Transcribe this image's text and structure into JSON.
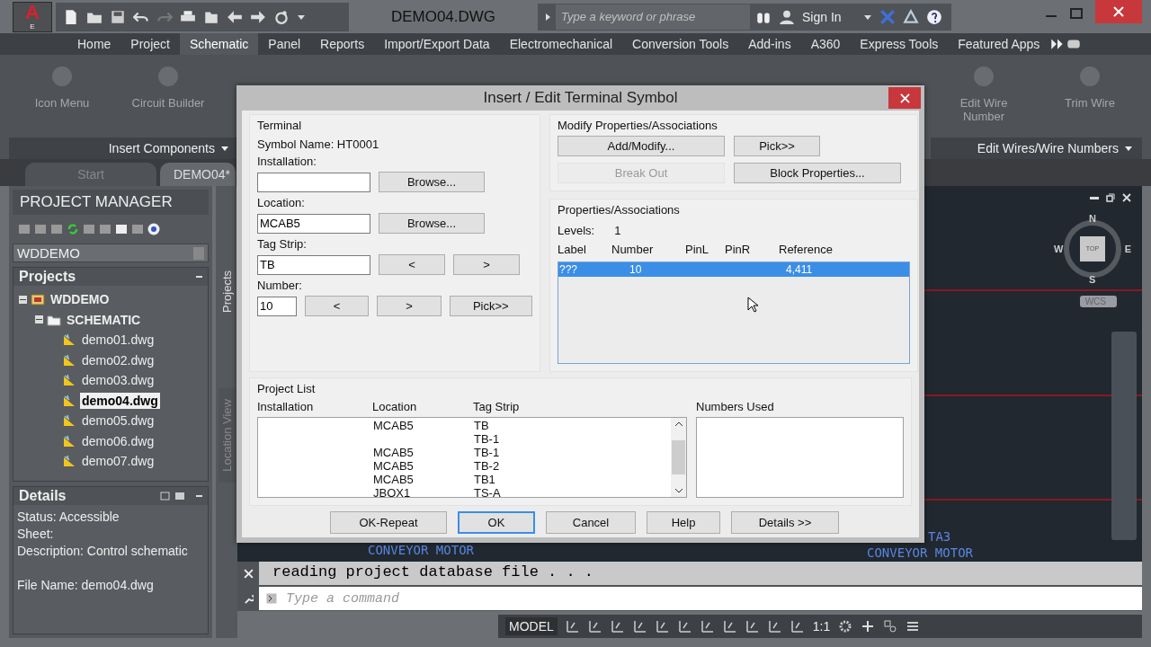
{
  "title_bar": {
    "app_letter": "A",
    "app_sub": "E",
    "document_title": "DEMO04.DWG",
    "search": {
      "placeholder": "Type a keyword or phrase"
    },
    "sign_in": "Sign In"
  },
  "ribbon_tabs": [
    {
      "label": "Home",
      "selected": false
    },
    {
      "label": "Project",
      "selected": false
    },
    {
      "label": "Schematic",
      "selected": true
    },
    {
      "label": "Panel",
      "selected": false
    },
    {
      "label": "Reports",
      "selected": false
    },
    {
      "label": "Import/Export Data",
      "selected": false
    },
    {
      "label": "Electromechanical",
      "selected": false
    },
    {
      "label": "Conversion Tools",
      "selected": false
    },
    {
      "label": "Add-ins",
      "selected": false
    },
    {
      "label": "A360",
      "selected": false
    },
    {
      "label": "Express Tools",
      "selected": false
    },
    {
      "label": "Featured Apps",
      "selected": false
    }
  ],
  "ribbon_panels": [
    {
      "title": "Insert Components",
      "tools": [
        "Icon Menu",
        "Circuit Builder"
      ]
    },
    {
      "title": "Edit Wires/Wire Numbers",
      "tools": [
        "Edit Wire Number",
        "Trim Wire"
      ]
    }
  ],
  "doc_tabs": [
    {
      "label": "Start",
      "selected": false
    },
    {
      "label": "DEMO04*",
      "selected": true
    }
  ],
  "project_manager": {
    "title": "PROJECT MANAGER",
    "project_select": "WDDEMO",
    "projects_header": "Projects",
    "tree": [
      {
        "label": "WDDEMO",
        "kind": "project",
        "expanded": true,
        "selected": false,
        "children": [
          {
            "label": "SCHEMATIC",
            "kind": "folder",
            "expanded": true,
            "selected": false,
            "children": [
              {
                "label": "demo01.dwg",
                "kind": "drawing",
                "selected": false
              },
              {
                "label": "demo02.dwg",
                "kind": "drawing",
                "selected": false
              },
              {
                "label": "demo03.dwg",
                "kind": "drawing",
                "selected": false
              },
              {
                "label": "demo04.dwg",
                "kind": "drawing",
                "selected": true
              },
              {
                "label": "demo05.dwg",
                "kind": "drawing",
                "selected": false
              },
              {
                "label": "demo06.dwg",
                "kind": "drawing",
                "selected": false
              },
              {
                "label": "demo07.dwg",
                "kind": "drawing",
                "selected": false
              }
            ]
          }
        ]
      }
    ],
    "details_header": "Details",
    "details": [
      "Status: Accessible",
      "Sheet:",
      "Description: Control schematic",
      "File Name: demo04.dwg"
    ],
    "side_tabs": [
      "Projects",
      "Location View"
    ]
  },
  "canvas": {
    "texts": [
      {
        "text": "CONVEYOR MOTOR"
      },
      {
        "text": "TA3"
      },
      {
        "text": "CONVEYOR MOTOR"
      }
    ],
    "viewcube": {
      "north": "N",
      "south": "S",
      "east": "E",
      "west": "W",
      "face": "TOP"
    },
    "wcs": "WCS"
  },
  "dialog": {
    "title": "Insert / Edit Terminal Symbol",
    "terminal": {
      "heading": "Terminal",
      "symbol_name": "Symbol Name: HT0001",
      "installation": {
        "label": "Installation:",
        "button": "Browse..."
      },
      "location": {
        "label": "Location:",
        "value": "MCAB5",
        "button": "Browse..."
      },
      "tag_strip": {
        "label": "Tag Strip:",
        "value": "TB",
        "buttons": [
          "<",
          ">"
        ]
      },
      "number": {
        "label": "Number:",
        "value": "10",
        "buttons": [
          "<",
          ">",
          "Pick>>"
        ]
      }
    },
    "modify": {
      "heading": "Modify Properties/Associations",
      "buttons": [
        {
          "label": "Add/Modify...",
          "disabled": false
        },
        {
          "label": "Pick>>",
          "disabled": false
        },
        {
          "label": "Break Out",
          "disabled": true
        },
        {
          "label": "Block Properties...",
          "disabled": false
        }
      ]
    },
    "properties": {
      "heading": "Properties/Associations",
      "levels_label": "Levels:",
      "levels_value": "1",
      "columns": [
        "Label",
        "Number",
        "PinL",
        "PinR",
        "Reference"
      ],
      "rows": [
        {
          "label": "???",
          "number": "10",
          "reference": "4,411",
          "selected": true
        }
      ]
    },
    "project_list": {
      "heading": "Project List",
      "columns": [
        "Installation",
        "Location",
        "Tag Strip"
      ],
      "rows": [
        {
          "location": "MCAB5",
          "tag_strip": "TB"
        },
        {
          "tag_strip": "TB-1"
        },
        {
          "location": "MCAB5",
          "tag_strip": "TB-1"
        },
        {
          "location": "MCAB5",
          "tag_strip": "TB-2"
        },
        {
          "location": "MCAB5",
          "tag_strip": "TB1"
        },
        {
          "location": "JBOX1",
          "tag_strip": "TS-A"
        }
      ],
      "numbers_used_header": "Numbers Used"
    },
    "footer_buttons": [
      {
        "label": "OK-Repeat",
        "default": false
      },
      {
        "label": "OK",
        "default": true
      },
      {
        "label": "Cancel",
        "default": false
      },
      {
        "label": "Help",
        "default": false
      },
      {
        "label": "Details >>",
        "default": false
      }
    ]
  },
  "command_line": {
    "history": "reading project database file . . .",
    "placeholder": "Type a command"
  },
  "status_bar": {
    "model": "MODEL",
    "scale": "1:1"
  }
}
